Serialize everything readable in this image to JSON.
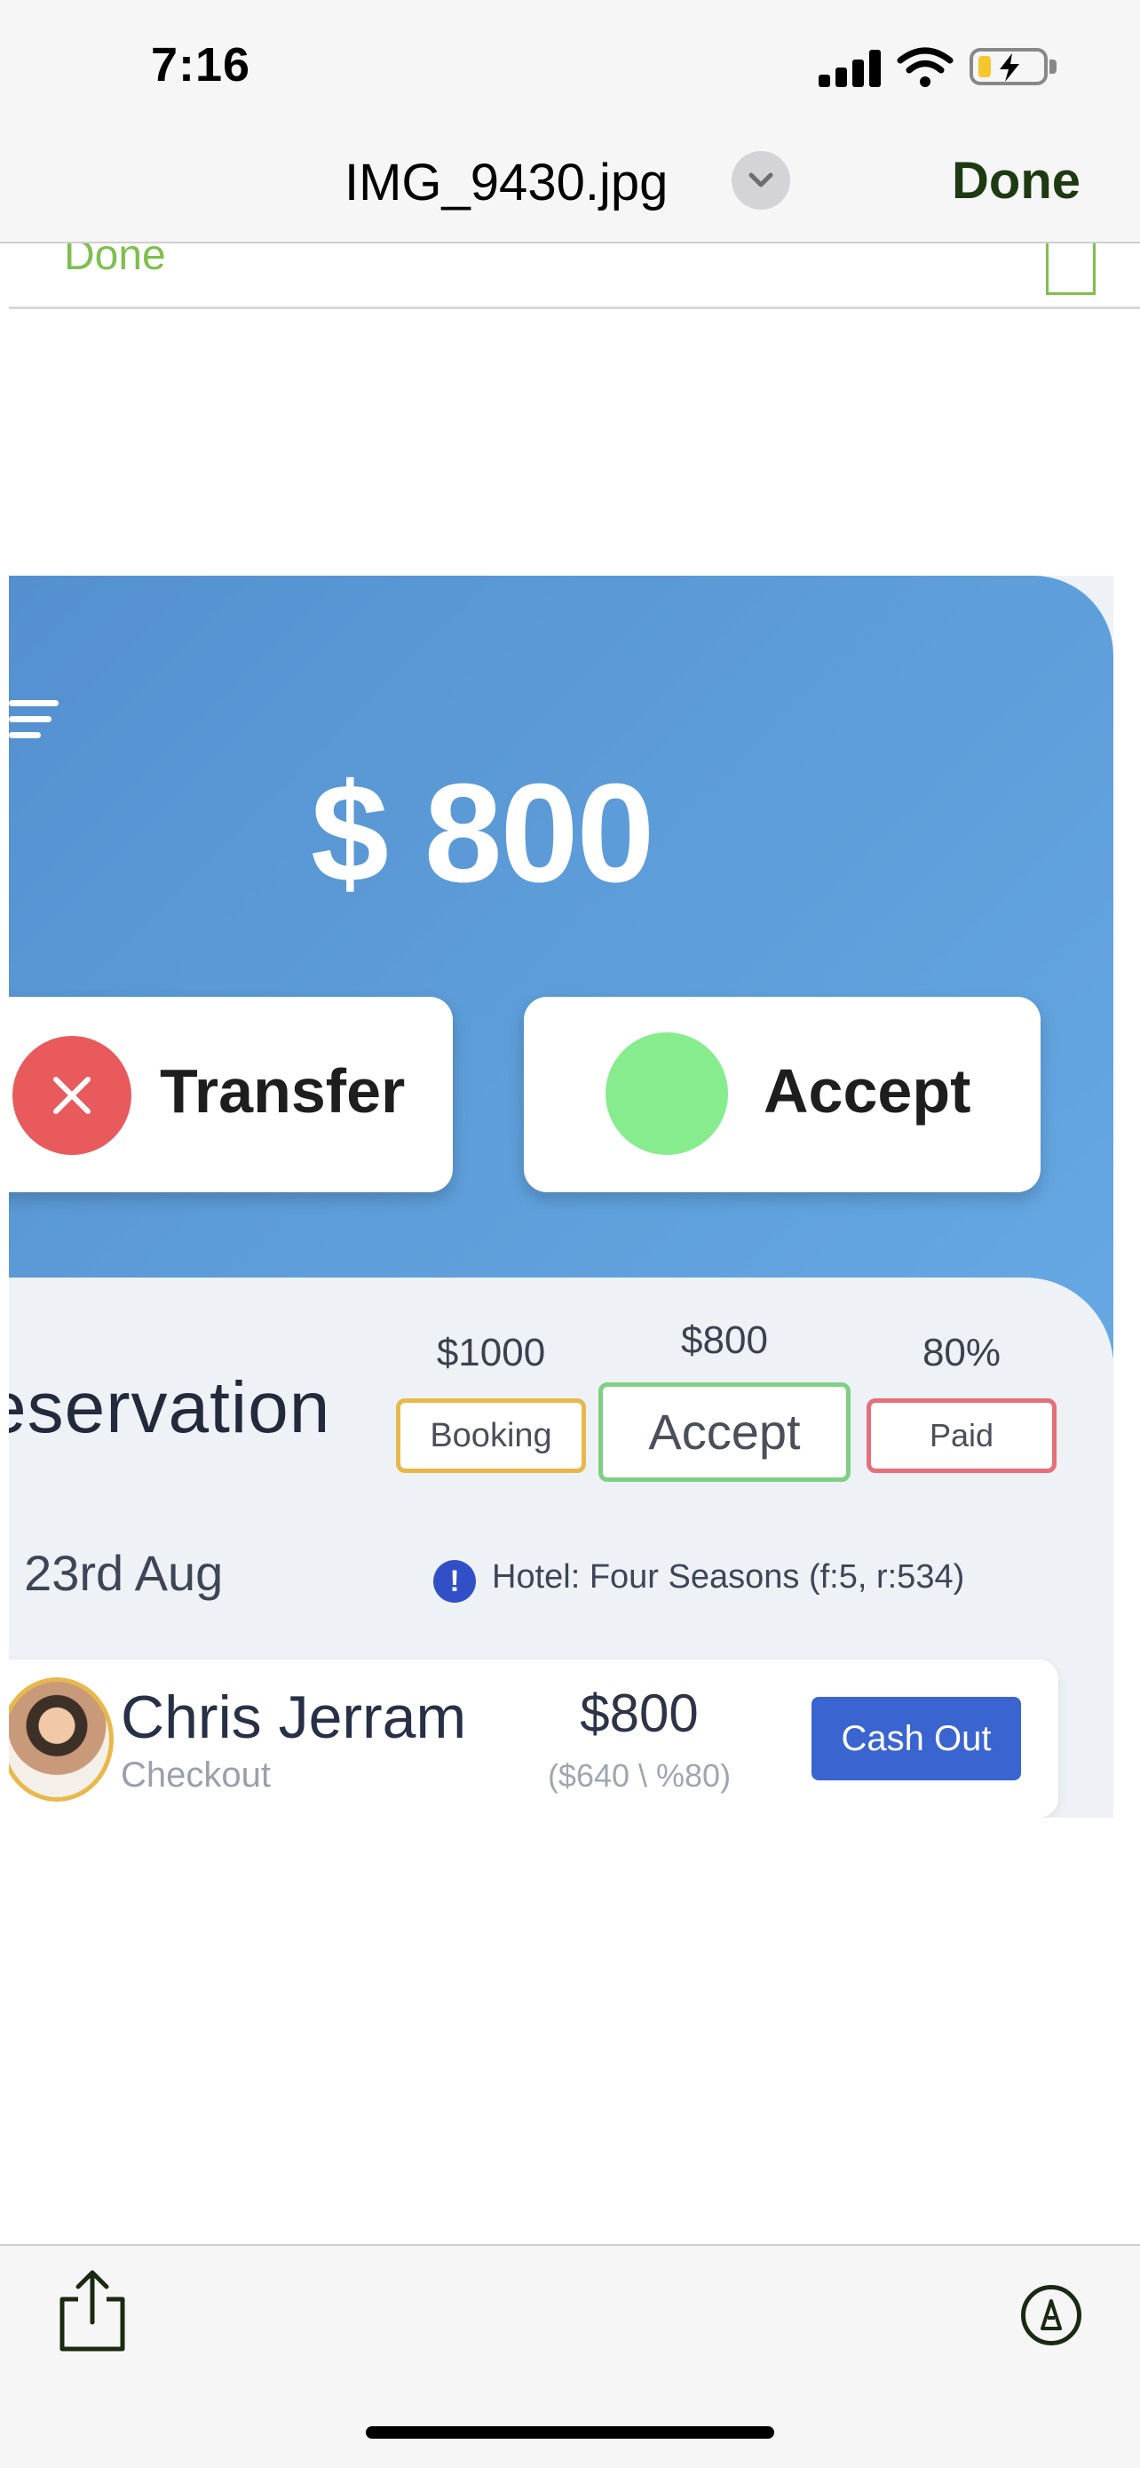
{
  "status_bar": {
    "time": "7:16"
  },
  "nav": {
    "title": "IMG_9430.jpg",
    "done_label": "Done"
  },
  "underlying_toolbar": {
    "done_label": "Done"
  },
  "photo": {
    "amount": "$ 800",
    "transfer_label": "Transfer",
    "accept_label": "Accept",
    "reservation_title": "eservation",
    "metrics": [
      {
        "value": "$1000",
        "tag": "Booking"
      },
      {
        "value": "$800",
        "tag": "Accept"
      },
      {
        "value": "80%",
        "tag": "Paid"
      }
    ],
    "date_text": ", 23rd Aug",
    "info_glyph": "!",
    "hotel_text": "Hotel:  Four Seasons (f:5, r:534)",
    "guest": {
      "name": "Chris Jerram",
      "status": "Checkout",
      "amount": "$800",
      "amount_sub": "($640 \\ %80)",
      "cashout_label": "Cash Out"
    }
  },
  "colors": {
    "hero_blue": "#5d9dd9",
    "done_green": "#1d3a12",
    "transfer_red": "#e85a5c",
    "accept_green": "#86ec8d",
    "cashout_blue": "#3a64cf"
  },
  "icons": [
    "signal-icon",
    "wifi-icon",
    "battery-charging-icon",
    "chevron-down-icon",
    "share-icon",
    "markup-icon",
    "menu-icon",
    "close-icon",
    "info-icon"
  ]
}
